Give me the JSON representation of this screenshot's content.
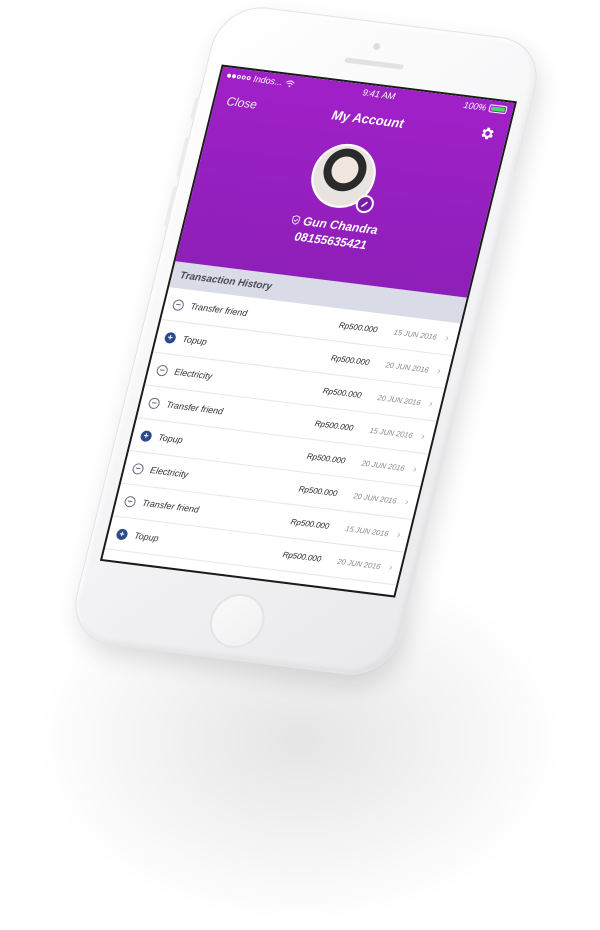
{
  "status": {
    "carrier": "Indos...",
    "time": "9:41 AM",
    "battery": "100%",
    "battery_level": 1.0
  },
  "nav": {
    "close_label": "Close",
    "title": "My Account",
    "settings_icon": "gear-icon"
  },
  "profile": {
    "name": "Gun Chandra",
    "phone": "08155635421",
    "verified_icon": "shield-check-icon",
    "edit_icon": "pencil-icon"
  },
  "section_title": "Transaction History",
  "transactions": [
    {
      "type": "minus",
      "label": "Transfer friend",
      "amount": "Rp500.000",
      "date": "15 JUN 2016"
    },
    {
      "type": "plus",
      "label": "Topup",
      "amount": "Rp500.000",
      "date": "20 JUN 2016"
    },
    {
      "type": "minus",
      "label": "Electricity",
      "amount": "Rp500.000",
      "date": "20 JUN 2016"
    },
    {
      "type": "minus",
      "label": "Transfer friend",
      "amount": "Rp500.000",
      "date": "15 JUN 2016"
    },
    {
      "type": "plus",
      "label": "Topup",
      "amount": "Rp500.000",
      "date": "20 JUN 2016"
    },
    {
      "type": "minus",
      "label": "Electricity",
      "amount": "Rp500.000",
      "date": "20 JUN 2016"
    },
    {
      "type": "minus",
      "label": "Transfer friend",
      "amount": "Rp500.000",
      "date": "15 JUN 2016"
    },
    {
      "type": "plus",
      "label": "Topup",
      "amount": "Rp500.000",
      "date": "20 JUN 2016"
    }
  ],
  "colors": {
    "header": "#9b1fc4",
    "section": "#d9dbe6",
    "plus_icon": "#2b4a8b"
  }
}
